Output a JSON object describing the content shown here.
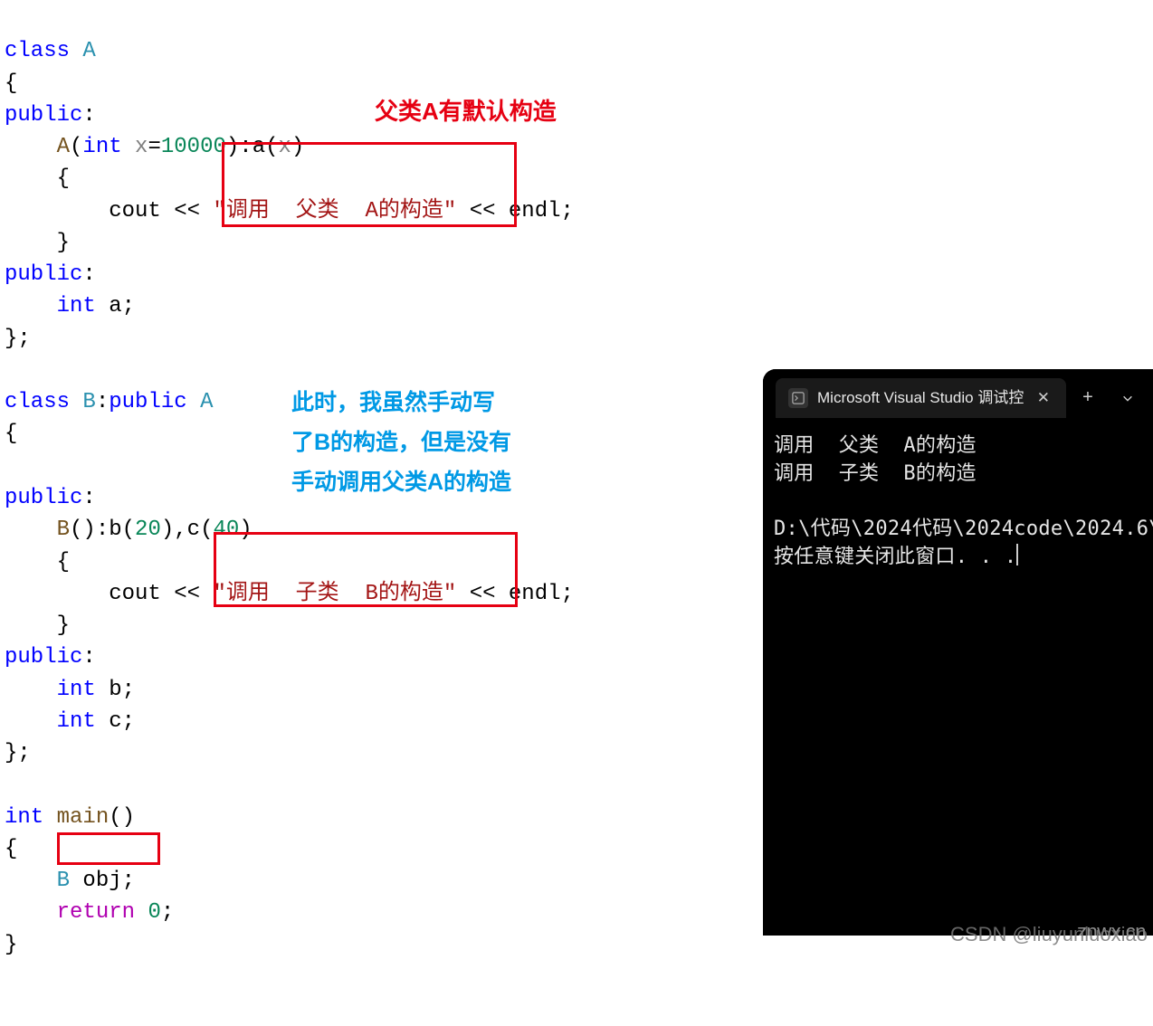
{
  "annotations": {
    "red": "父类A有默认构造",
    "blue_l1": "此时，我虽然手动写",
    "blue_l2": "了B的构造，但是没有",
    "blue_l3": "手动调用父类A的构造"
  },
  "code": {
    "class_kw": "class",
    "A": "A",
    "public_kw": "public",
    "int_kw": "int",
    "x_var": "x",
    "def_val": "10000",
    "a_var": "a",
    "cout": "cout",
    "lshift": "<<",
    "str_a": "\"调用  父类  A的构造\"",
    "endl": "endl",
    "B": "B",
    "b_var": "b",
    "c_var": "c",
    "b_init": "20",
    "c_init": "40",
    "str_b": "\"调用  子类  B的构造\"",
    "main": "main",
    "obj": "obj",
    "return_kw": "return",
    "zero": "0"
  },
  "terminal": {
    "tab_title": "Microsoft Visual Studio 调试控",
    "out1": "调用  父类  A的构造",
    "out2": "调用  子类  B的构造",
    "path": "D:\\代码\\2024代码\\2024code\\2024.6\\",
    "prompt": "按任意键关闭此窗口. . ."
  },
  "watermark": {
    "w1": "znwx.cn",
    "w2": "CSDN @liuyunluoxiao"
  }
}
